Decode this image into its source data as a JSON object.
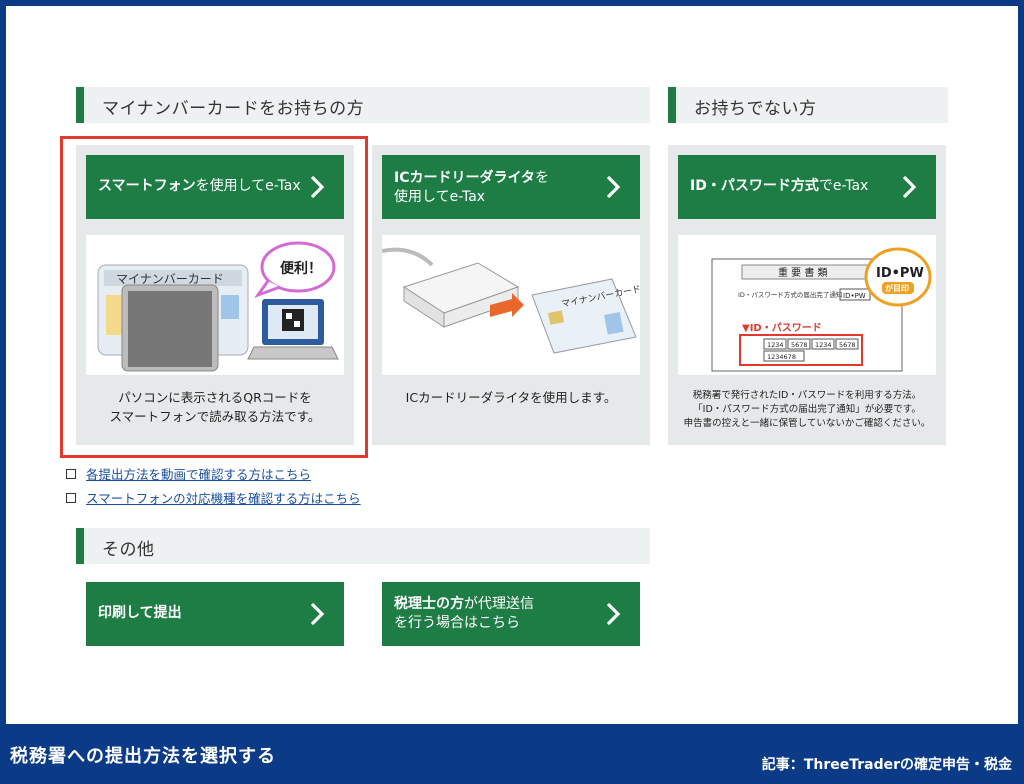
{
  "sections": {
    "mynumber_title": "マイナンバーカードをお持ちの方",
    "no_card_title": "お持ちでない方",
    "other_title": "その他"
  },
  "cards": {
    "smartphone": {
      "label_bold": "スマートフォン",
      "label_rest": "を使用してe-Tax",
      "illus_card_title": "マイナンバーカード",
      "bubble": "便利！",
      "desc_line1": "パソコンに表示されるQRコードを",
      "desc_line2": "スマートフォンで読み取る方法です。"
    },
    "ic_reader": {
      "label_line1_bold": "ICカードリーダライタ",
      "label_line1_rest": "を",
      "label_line2": "使用してe-Tax",
      "illus_card_title": "マイナンバーカード",
      "desc": "ICカードリーダライタを使用します。"
    },
    "idpw": {
      "label_bold": "ID・パスワード方式",
      "label_rest": "でe-Tax",
      "doc_title": "重 要 書 類",
      "doc_sub": "ID・パスワード方式の届出完了通知",
      "doc_tag": "ID•PW",
      "bubble_line1": "ID•PW",
      "bubble_line2": "が目印",
      "doc_section": "▼ID・パスワード",
      "doc_codes": [
        "1234",
        "5678",
        "1234",
        "5678"
      ],
      "doc_id": "1234678",
      "desc_line1": "税務署で発行されたID・パスワードを利用する方法。",
      "desc_line2": "「ID・パスワード方式の届出完了通知」が必要です。",
      "desc_line3": "申告書の控えと一緒に保管していないかご確認ください。"
    }
  },
  "links": [
    "各提出方法を動画で確認する方はこちら",
    "スマートフォンの対応機種を確認する方はこちら"
  ],
  "other_buttons": {
    "print": "印刷して提出",
    "tax_bold": "税理士の方",
    "tax_rest": "が代理送信",
    "tax_line2": "を行う場合はこちら"
  },
  "footer": {
    "left": "税務署への提出方法を選択する",
    "right": "記事：ThreeTraderの確定申告・税金"
  },
  "colors": {
    "green": "#1e7c45",
    "navy": "#0b3a86",
    "highlight_red": "#e0392e"
  }
}
